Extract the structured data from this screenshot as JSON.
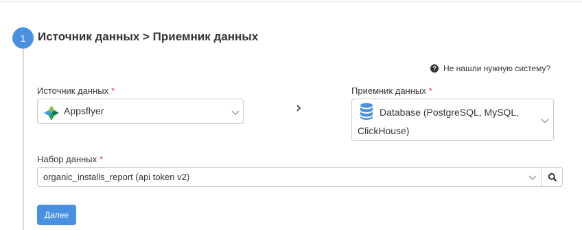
{
  "step": {
    "number": "1",
    "title": "Источник данных > Приемник данных"
  },
  "help": {
    "icon": "question-circle-icon",
    "text": "Не нашли нужную систему?"
  },
  "source": {
    "label": "Источник данных",
    "required_mark": "*",
    "value": "Appsflyer",
    "logo": "appsflyer-logo"
  },
  "destination": {
    "label": "Приемник данных",
    "required_mark": "*",
    "value": "Database (PostgreSQL, MySQL, ClickHouse)",
    "icon": "database-icon"
  },
  "dataset": {
    "label": "Набор данных",
    "required_mark": "*",
    "value": "organic_installs_report (api token v2)",
    "search_icon": "search-icon"
  },
  "actions": {
    "next_label": "Далее"
  },
  "colors": {
    "accent": "#4a90e2",
    "required": "#e0323c",
    "text": "#333333",
    "border": "#cccccc"
  }
}
